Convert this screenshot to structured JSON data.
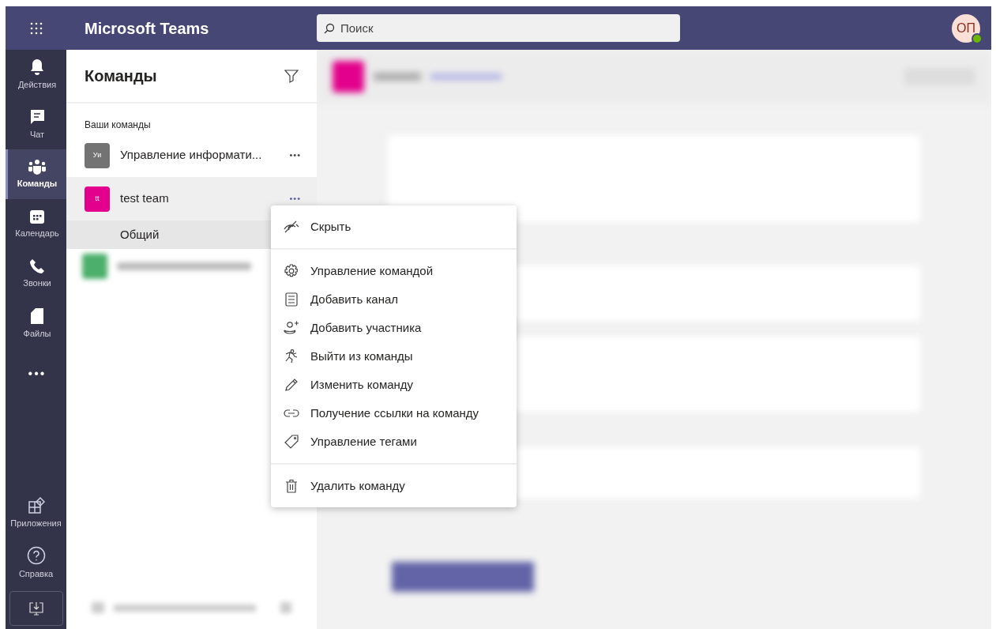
{
  "app": {
    "title": "Microsoft Teams"
  },
  "search": {
    "placeholder": "Поиск"
  },
  "user": {
    "initials": "ОП"
  },
  "rail": [
    {
      "label": "Действия",
      "kind": "bell",
      "selected": false
    },
    {
      "label": "Чат",
      "kind": "chat",
      "selected": false
    },
    {
      "label": "Команды",
      "kind": "teams",
      "selected": true
    },
    {
      "label": "Календарь",
      "kind": "calendar",
      "selected": false
    },
    {
      "label": "Звонки",
      "kind": "phone",
      "selected": false
    },
    {
      "label": "Файлы",
      "kind": "file",
      "selected": false
    },
    {
      "label": "•••",
      "kind": "more",
      "selected": false
    }
  ],
  "rail_bottom": [
    {
      "label": "Приложения",
      "kind": "apps"
    },
    {
      "label": "Справка",
      "kind": "help"
    }
  ],
  "teams_panel": {
    "title": "Команды",
    "section": "Ваши команды",
    "teams": [
      {
        "name": "Управление информати...",
        "initials": "Уи",
        "color": "#737373",
        "selected": false,
        "more": "•••"
      },
      {
        "name": "test team",
        "initials": "tt",
        "color": "#e3008c",
        "selected": true,
        "more": "•••",
        "channels": [
          {
            "name": "Общий",
            "selected": true
          }
        ]
      }
    ]
  },
  "context_menu": {
    "sections": [
      [
        {
          "label": "Скрыть",
          "kind": "hide"
        }
      ],
      [
        {
          "label": "Управление командой",
          "kind": "gear"
        },
        {
          "label": "Добавить канал",
          "kind": "channel"
        },
        {
          "label": "Добавить участника",
          "kind": "person-add"
        },
        {
          "label": "Выйти из команды",
          "kind": "leave"
        },
        {
          "label": "Изменить команду",
          "kind": "pencil"
        },
        {
          "label": "Получение ссылки на команду",
          "kind": "link"
        },
        {
          "label": "Управление тегами",
          "kind": "tag"
        }
      ],
      [
        {
          "label": "Удалить команду",
          "kind": "trash"
        }
      ]
    ]
  }
}
